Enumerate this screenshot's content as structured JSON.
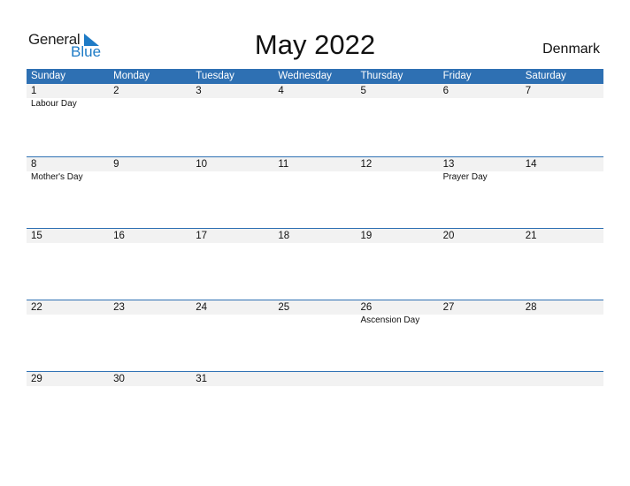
{
  "logo": {
    "general": "General",
    "blue": "Blue"
  },
  "title": "May 2022",
  "country": "Denmark",
  "colors": {
    "header": "#2e70b3",
    "accent": "#1e7bc6"
  },
  "days": [
    "Sunday",
    "Monday",
    "Tuesday",
    "Wednesday",
    "Thursday",
    "Friday",
    "Saturday"
  ],
  "weeks": [
    {
      "nums": [
        "1",
        "2",
        "3",
        "4",
        "5",
        "6",
        "7"
      ],
      "events": [
        "Labour Day",
        "",
        "",
        "",
        "",
        "",
        ""
      ]
    },
    {
      "nums": [
        "8",
        "9",
        "10",
        "11",
        "12",
        "13",
        "14"
      ],
      "events": [
        "Mother's Day",
        "",
        "",
        "",
        "",
        "Prayer Day",
        ""
      ]
    },
    {
      "nums": [
        "15",
        "16",
        "17",
        "18",
        "19",
        "20",
        "21"
      ],
      "events": [
        "",
        "",
        "",
        "",
        "",
        "",
        ""
      ]
    },
    {
      "nums": [
        "22",
        "23",
        "24",
        "25",
        "26",
        "27",
        "28"
      ],
      "events": [
        "",
        "",
        "",
        "",
        "Ascension Day",
        "",
        ""
      ]
    },
    {
      "nums": [
        "29",
        "30",
        "31",
        "",
        "",
        "",
        ""
      ],
      "events": [
        "",
        "",
        "",
        "",
        "",
        "",
        ""
      ]
    }
  ]
}
